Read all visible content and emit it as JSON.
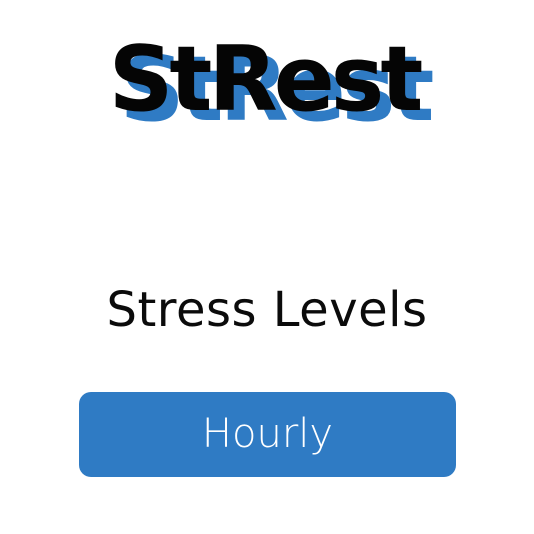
{
  "app": {
    "logo_text": "StRest"
  },
  "main": {
    "heading": "Stress Levels",
    "hourly_button_label": "Hourly"
  },
  "colors": {
    "accent": "#2f7bc4",
    "logo_text": "#050505",
    "background": "#ffffff"
  }
}
